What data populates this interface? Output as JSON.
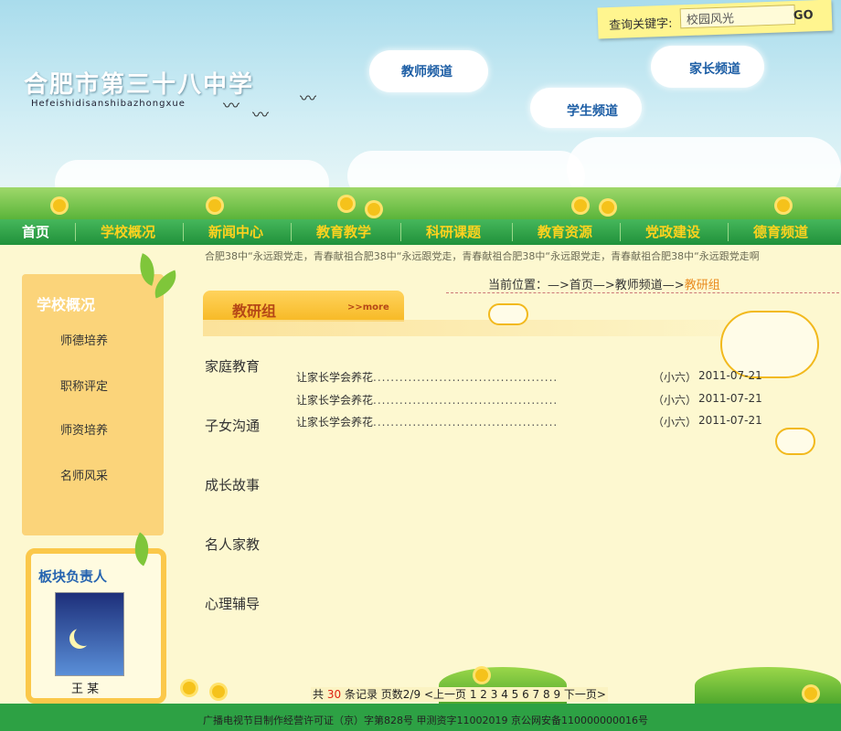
{
  "header": {
    "school_name": "合肥市第三十八中学",
    "school_pinyin": "Hefeishidisanshibazhongxue",
    "search_label": "查询关键字:",
    "search_value": "校园风光",
    "search_button": "GO"
  },
  "channels": {
    "teacher": "教师频道",
    "student": "学生频道",
    "parent": "家长频道"
  },
  "nav": [
    "首页",
    "学校概况",
    "新闻中心",
    "教育教学",
    "科研课题",
    "教育资源",
    "党政建设",
    "德育频道"
  ],
  "ticker": "合肥38中“永远跟党走，青春献祖合肥38中“永远跟党走，青春献祖合肥38中“永远跟党走，青春献祖合肥38中“永远跟党走啊",
  "sidebar": {
    "title": "学校概况",
    "items": [
      "师德培养",
      "职称评定",
      "师资培养",
      "名师风采"
    ]
  },
  "owner": {
    "title": "板块负责人",
    "name": "王 某"
  },
  "breadcrumb": {
    "prefix": "当前位置：—>首页—>教师频道—>",
    "current": "教研组"
  },
  "section": {
    "title": "教研组",
    "more": ">>more"
  },
  "categories": [
    "家庭教育",
    "子女沟通",
    "成长故事",
    "名人家教",
    "心理辅导"
  ],
  "articles": [
    {
      "title": "让家长学会养花",
      "dots": "..........................................",
      "author": "（小六）",
      "date": "2011-07-21"
    },
    {
      "title": "让家长学会养花",
      "dots": "..........................................",
      "author": "（小六）",
      "date": "2011-07-21"
    },
    {
      "title": "让家长学会养花",
      "dots": "..........................................",
      "author": "（小六）",
      "date": "2011-07-21"
    }
  ],
  "pager": {
    "total_prefix": "共",
    "total": "30",
    "total_suffix": "条记录",
    "pages": "页数2/9",
    "prev": "<上一页",
    "numbers": "1 2 3 4 5 6 7 8 9",
    "next": "下一页>"
  },
  "footer": "广播电视节目制作经营许可证（京）字第828号 甲测资字11002019 京公网安备110000000016号",
  "colors": {
    "nav_green": "#2da144",
    "nav_text": "#ffd21e",
    "accent_orange": "#e98b1f",
    "channel_blue": "#1d5ea5"
  }
}
